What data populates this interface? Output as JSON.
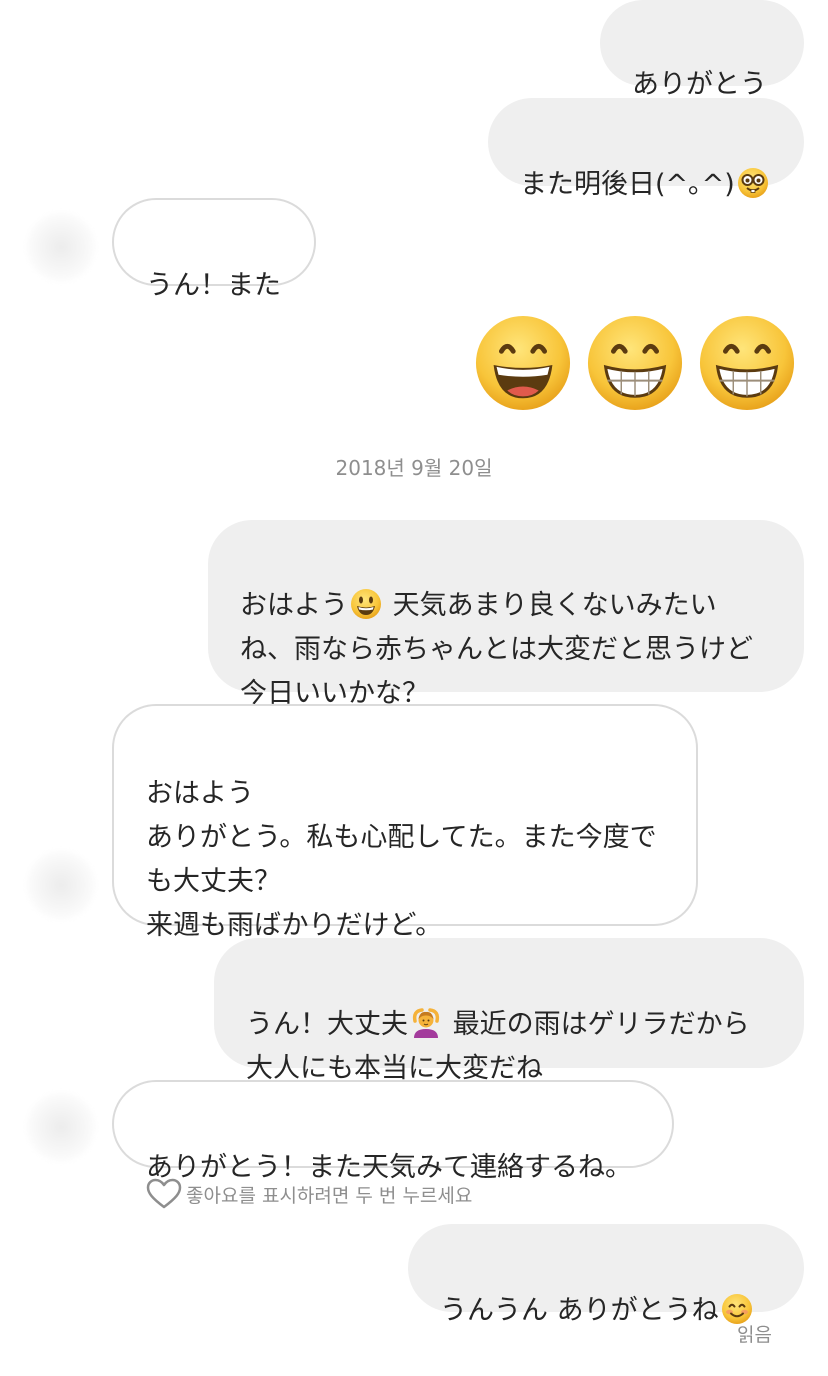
{
  "messages": {
    "m1": {
      "text": "ありがとう"
    },
    "m2": {
      "text": "また明後日(^｡^)",
      "emoji": "nerd-face"
    },
    "m3": {
      "text": "うん！また"
    },
    "m4": {
      "emoji": [
        "grinning-squinting-face",
        "grinning-face-with-big-eyes",
        "grinning-face-with-big-eyes"
      ]
    },
    "m5": {
      "part1": "おはよう",
      "part2": " 天気あまり良くないみたい\nね、雨なら赤ちゃんとは大変だと思うけど\n今日いいかな？",
      "emoji": "smiley-face"
    },
    "m6": {
      "text": "おはよう\nありがとう。私も心配してた。また今度で\nも大丈夫？\n来週も雨ばかりだけど。"
    },
    "m7": {
      "part1": "うん！大丈夫",
      "part2": " 最近の雨はゲリラだから\n大人にも本当に大変だね",
      "emoji": "person-gesturing-ok"
    },
    "m8": {
      "text": "ありがとう！また天気みて連絡するね。"
    },
    "m9": {
      "text": "うんうん ありがとうね",
      "emoji": "smiling-face-with-smiling-eyes"
    }
  },
  "timestamp": "2018년 9월 20일",
  "like_hint": "좋아요를 표시하려면 두 번 누르세요",
  "seen_label": "읽음",
  "colors": {
    "sent_bubble": "#efefef",
    "received_border": "#dbdbdb",
    "text": "#262626",
    "meta_text": "#8e8e8e",
    "emoji_yellow": "#f5c33b"
  }
}
